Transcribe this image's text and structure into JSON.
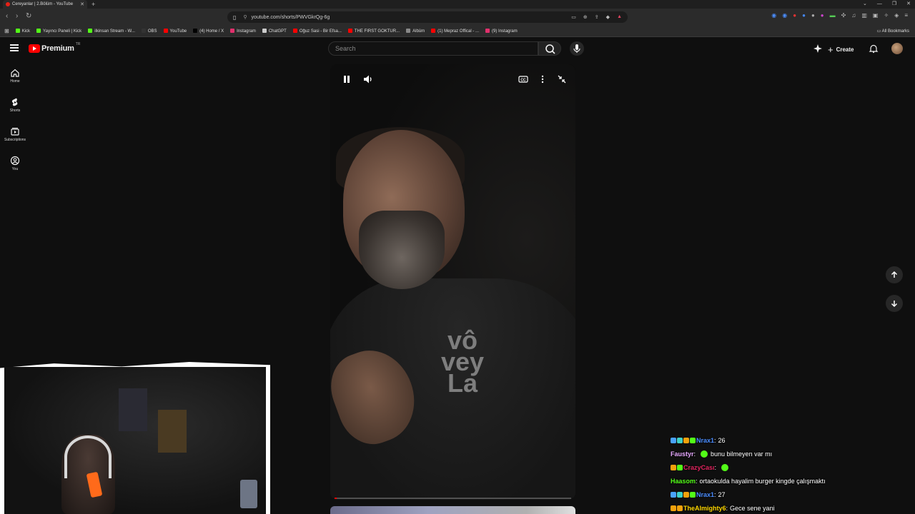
{
  "browser": {
    "tab_title": "Cereyanlar | 2.Bölüm - YouTube",
    "url": "youtube.com/shorts/PWVGkrQg-6g",
    "bookmarks": [
      {
        "label": "Kick",
        "color": "#53fc18"
      },
      {
        "label": "Yayıncı Paneli | Kick",
        "color": "#53fc18"
      },
      {
        "label": "ilkinsan Stream - W...",
        "color": "#53fc18"
      },
      {
        "label": "OBS",
        "color": "#333333"
      },
      {
        "label": "YouTube",
        "color": "#ff0000"
      },
      {
        "label": "(4) Home / X",
        "color": "#000000"
      },
      {
        "label": "Instagram",
        "color": "#e1306c"
      },
      {
        "label": "ChatGPT",
        "color": "#cccccc"
      },
      {
        "label": "Oğuz Sasi - Bir Efsa...",
        "color": "#ff0000"
      },
      {
        "label": "THE FIRST GOKTUR...",
        "color": "#ff0000"
      },
      {
        "label": "Albüm",
        "color": "#888888"
      },
      {
        "label": "(1) Mepraz Offical - ...",
        "color": "#ff0000"
      },
      {
        "label": "(9) Instagram",
        "color": "#e1306c"
      }
    ],
    "all_bookmarks_label": "All Bookmarks"
  },
  "youtube": {
    "logo_text": "Premium",
    "logo_region": "TR",
    "search_placeholder": "Search",
    "create_label": "Create",
    "rail": [
      {
        "label": "Home",
        "icon": "home-icon"
      },
      {
        "label": "Shorts",
        "icon": "shorts-icon"
      },
      {
        "label": "Subscriptions",
        "icon": "subscriptions-icon"
      },
      {
        "label": "You",
        "icon": "you-icon"
      }
    ]
  },
  "short": {
    "shirt_text_lines": [
      "vô",
      "vey",
      "La"
    ],
    "progress_fraction": 0.01,
    "accent_color": "#ff0000"
  },
  "chat": [
    {
      "user": "Nrax1",
      "user_color": "#4a8dff",
      "message": "26",
      "badges": [
        "#4aa3ff",
        "#3fd1c8",
        "#f2a20c",
        "#53fc18"
      ],
      "emote": null
    },
    {
      "user": "Faustyr",
      "user_color": "#e6a8ff",
      "message": "bunu bilmeyen var mı",
      "badges": [],
      "emote": "#53fc18",
      "emote_before": true
    },
    {
      "user": "CrazyCası",
      "user_color": "#e0245e",
      "message": "",
      "badges": [
        "#f2a20c",
        "#53fc18"
      ],
      "emote": "#53fc18"
    },
    {
      "user": "Haasom",
      "user_color": "#53fc18",
      "message": "ortaokulda hayalim burger kingde çalışmaktı",
      "badges": [],
      "emote": null
    },
    {
      "user": "Nrax1",
      "user_color": "#4a8dff",
      "message": "27",
      "badges": [
        "#4aa3ff",
        "#3fd1c8",
        "#f2a20c",
        "#53fc18"
      ],
      "emote": null
    },
    {
      "user": "TheAlmighty6",
      "user_color": "#ffd700",
      "message": "Gece sene yani",
      "badges": [
        "#f2a20c",
        "#f2a20c"
      ],
      "emote": null
    }
  ]
}
